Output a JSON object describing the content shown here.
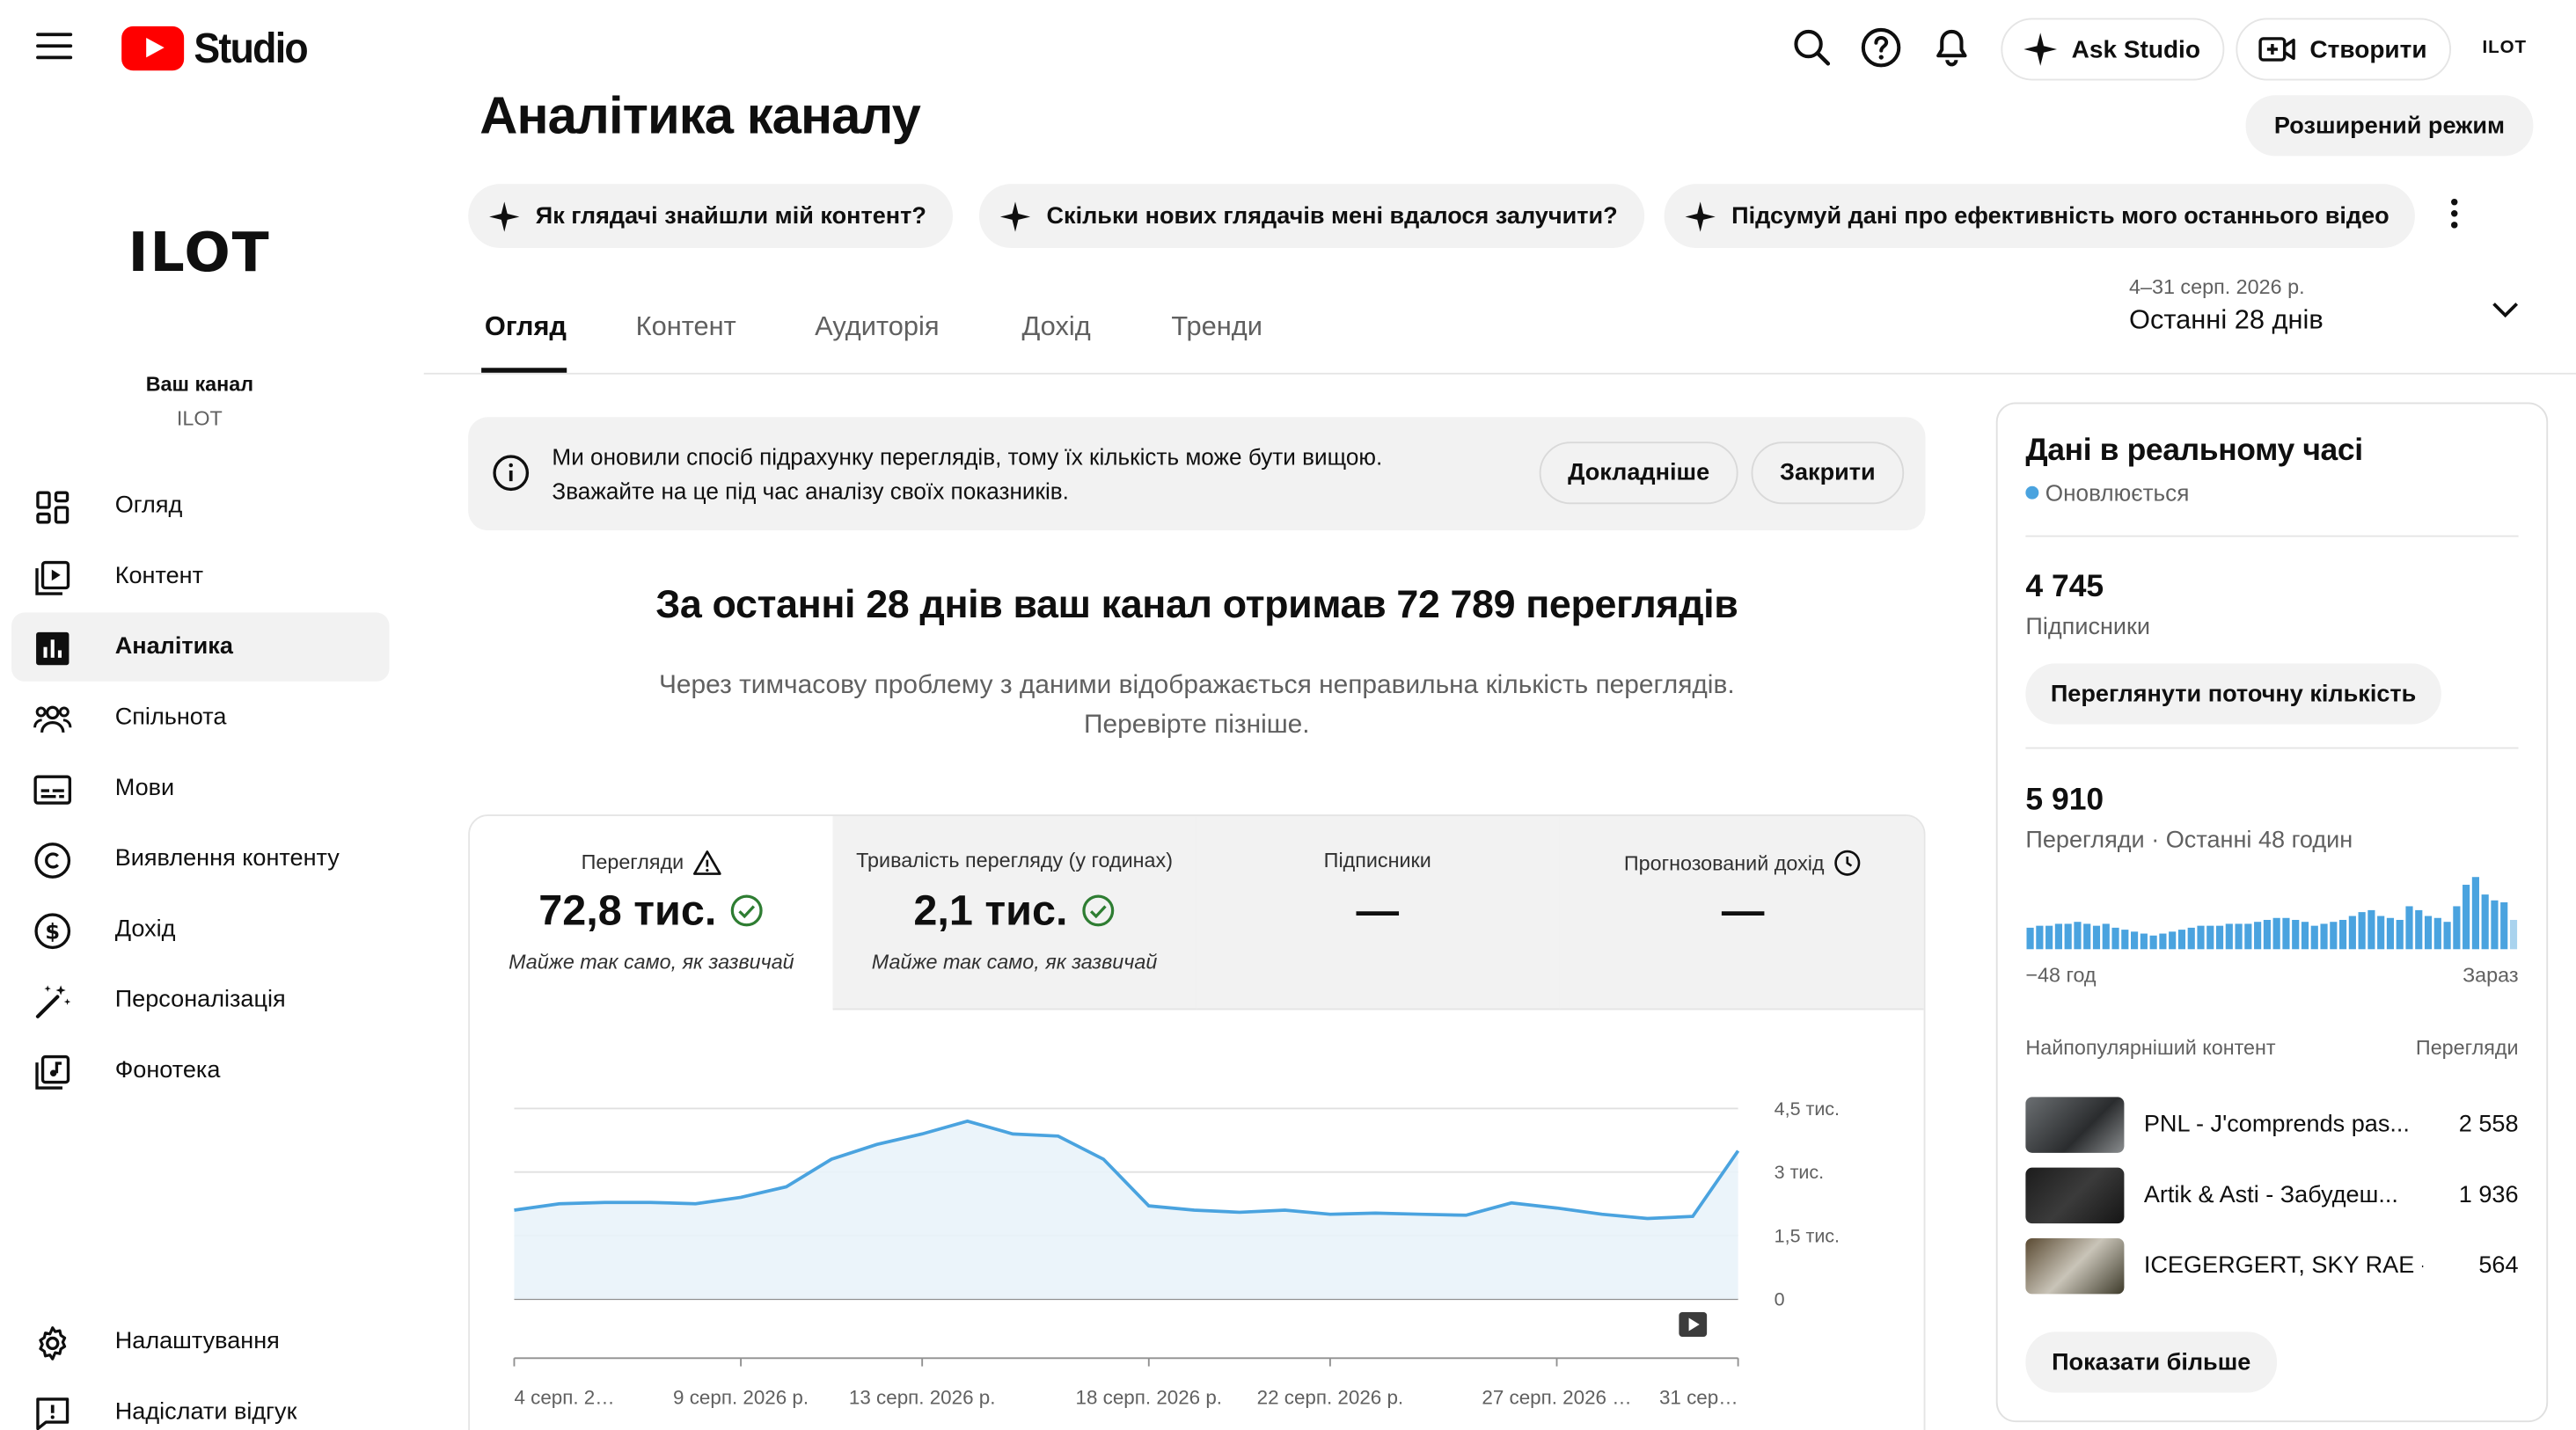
{
  "topbar": {
    "logo_text": "Studio",
    "ask_label": "Ask Studio",
    "create_label": "Створити",
    "avatar_text": "ILOT"
  },
  "sidebar": {
    "channel_logo": "ILOT",
    "your_channel": "Ваш канал",
    "channel_name": "ILOT",
    "items": [
      {
        "label": "Огляд",
        "icon": "dashboard-icon"
      },
      {
        "label": "Контент",
        "icon": "content-icon"
      },
      {
        "label": "Аналітика",
        "icon": "analytics-icon"
      },
      {
        "label": "Спільнота",
        "icon": "community-icon"
      },
      {
        "label": "Мови",
        "icon": "subtitles-icon"
      },
      {
        "label": "Виявлення контенту",
        "icon": "copyright-icon"
      },
      {
        "label": "Дохід",
        "icon": "dollar-icon"
      },
      {
        "label": "Персоналізація",
        "icon": "magic-wand-icon"
      },
      {
        "label": "Фонотека",
        "icon": "audio-library-icon"
      }
    ],
    "settings_label": "Налаштування",
    "feedback_label": "Надіслати відгук"
  },
  "header": {
    "title": "Аналітика каналу",
    "advanced_mode": "Розширений режим",
    "chips": [
      "Як глядачі знайшли мій контент?",
      "Скільки нових глядачів мені вдалося залучити?",
      "Підсумуй дані про ефективність мого останнього відео"
    ],
    "tabs": [
      "Огляд",
      "Контент",
      "Аудиторія",
      "Дохід",
      "Тренди"
    ],
    "date_small": "4–31 серп. 2026 р.",
    "date_big": "Останні 28 днів"
  },
  "notice": {
    "line1": "Ми оновили спосіб підрахунку переглядів, тому їх кількість може бути вищою.",
    "line2": "Зважайте на це під час аналізу своїх показників.",
    "more_label": "Докладніше",
    "close_label": "Закрити"
  },
  "summary": {
    "headline": "За останні 28 днів ваш канал отримав 72 789 переглядів",
    "sub1": "Через тимчасову проблему з даними відображається неправильна кількість переглядів.",
    "sub2": "Перевірте пізніше."
  },
  "metrics": [
    {
      "label": "Перегляди",
      "value": "72,8 тис.",
      "note": "Майже так само, як зазвичай"
    },
    {
      "label": "Тривалість перегляду (у годинах)",
      "value": "2,1 тис.",
      "note": "Майже так само, як зазвичай"
    },
    {
      "label": "Підписники",
      "value": "—",
      "note": ""
    },
    {
      "label": "Прогнозований дохід",
      "value": "—",
      "note": ""
    }
  ],
  "chart_data": {
    "type": "area",
    "x_labels": [
      "4 серп. 2…",
      "9 серп. 2026 р.",
      "13 серп. 2026 р.",
      "18 серп. 2026 р.",
      "22 серп. 2026 р.",
      "27 серп. 2026 …",
      "31 сер…"
    ],
    "y_ticks": [
      "0",
      "1,5 тис.",
      "3 тис.",
      "4,5 тис."
    ],
    "ylim": [
      0,
      4500
    ],
    "values": [
      2100,
      2250,
      2280,
      2280,
      2250,
      2400,
      2650,
      3300,
      3650,
      3900,
      4200,
      3900,
      3850,
      3300,
      2200,
      2100,
      2050,
      2100,
      2000,
      2030,
      2000,
      1980,
      2270,
      2150,
      2000,
      1900,
      1950,
      3500
    ],
    "grid": true,
    "color": "#4aa3df"
  },
  "realtime": {
    "title": "Дані в реальному часі",
    "status": "Оновлюється",
    "subs_value": "4 745",
    "subs_label": "Підписники",
    "subs_button": "Переглянути поточну кількість",
    "views_value": "5 910",
    "views_label": "Перегляди · Останні 48 годин",
    "axis_left": "−48 год",
    "axis_right": "Зараз",
    "bars": [
      11,
      12,
      12,
      13,
      13,
      14,
      13,
      12,
      13,
      11,
      10,
      9,
      8,
      7,
      8,
      9,
      10,
      11,
      12,
      12,
      12,
      13,
      13,
      13,
      14,
      15,
      16,
      16,
      15,
      14,
      12,
      13,
      14,
      15,
      17,
      19,
      20,
      17,
      16,
      15,
      22,
      20,
      17,
      16,
      14,
      22,
      33,
      37,
      28,
      25,
      24,
      15
    ],
    "top_head": "Найпопулярніший контент",
    "top_col": "Перегляди",
    "top": [
      {
        "title": "PNL - J'comprends pas...",
        "views": "2 558"
      },
      {
        "title": "Artik & Asti - Забудеш...",
        "views": "1 936"
      },
      {
        "title": "ICEGERGERT, SKY RAE - ...",
        "views": "564"
      }
    ],
    "show_more": "Показати більше"
  }
}
